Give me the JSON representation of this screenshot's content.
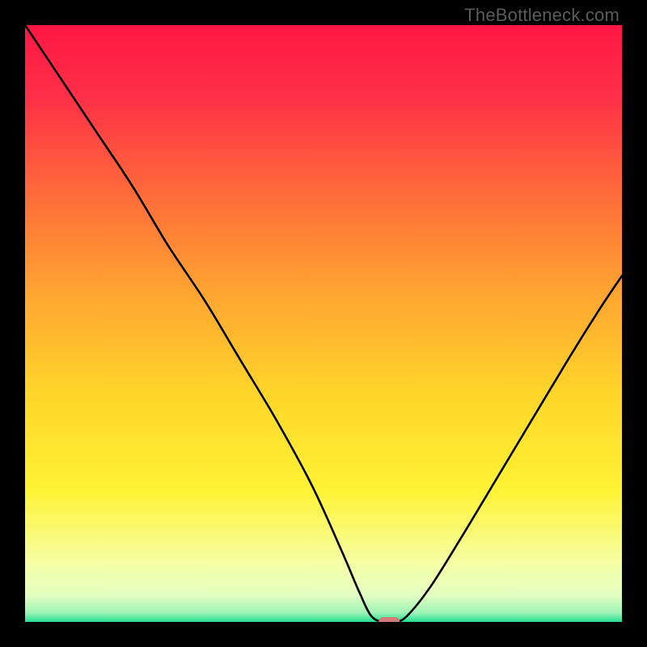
{
  "watermark": "TheBottleneck.com",
  "chart_data": {
    "type": "line",
    "title": "",
    "xlabel": "",
    "ylabel": "",
    "xlim": [
      0,
      100
    ],
    "ylim": [
      0,
      100
    ],
    "grid": false,
    "legend": false,
    "background": {
      "type": "vertical-gradient",
      "stops": [
        {
          "pos": 0.0,
          "color": "#ff1744"
        },
        {
          "pos": 0.12,
          "color": "#ff2f47"
        },
        {
          "pos": 0.28,
          "color": "#ff6a3a"
        },
        {
          "pos": 0.45,
          "color": "#ffa531"
        },
        {
          "pos": 0.62,
          "color": "#ffd629"
        },
        {
          "pos": 0.78,
          "color": "#fff335"
        },
        {
          "pos": 0.9,
          "color": "#f6ffa4"
        },
        {
          "pos": 0.955,
          "color": "#e4ffc2"
        },
        {
          "pos": 0.985,
          "color": "#9cf3b5"
        },
        {
          "pos": 1.0,
          "color": "#20df8f"
        }
      ]
    },
    "series": [
      {
        "name": "bottleneck-curve",
        "color": "#000000",
        "width": 2.6,
        "x": [
          0,
          6,
          12,
          18,
          24,
          30,
          36,
          42,
          48,
          53,
          56,
          58,
          60,
          62,
          64,
          68,
          73,
          79,
          85,
          91,
          96,
          100
        ],
        "values": [
          100,
          91,
          82,
          73,
          63,
          54,
          44,
          34,
          23,
          12,
          5,
          1,
          0,
          0,
          1,
          6,
          14,
          24,
          34,
          44,
          52,
          58
        ]
      }
    ],
    "marker": {
      "name": "min-point",
      "x": 61,
      "y": 0,
      "color": "#d47a7a",
      "shape": "capsule"
    }
  }
}
